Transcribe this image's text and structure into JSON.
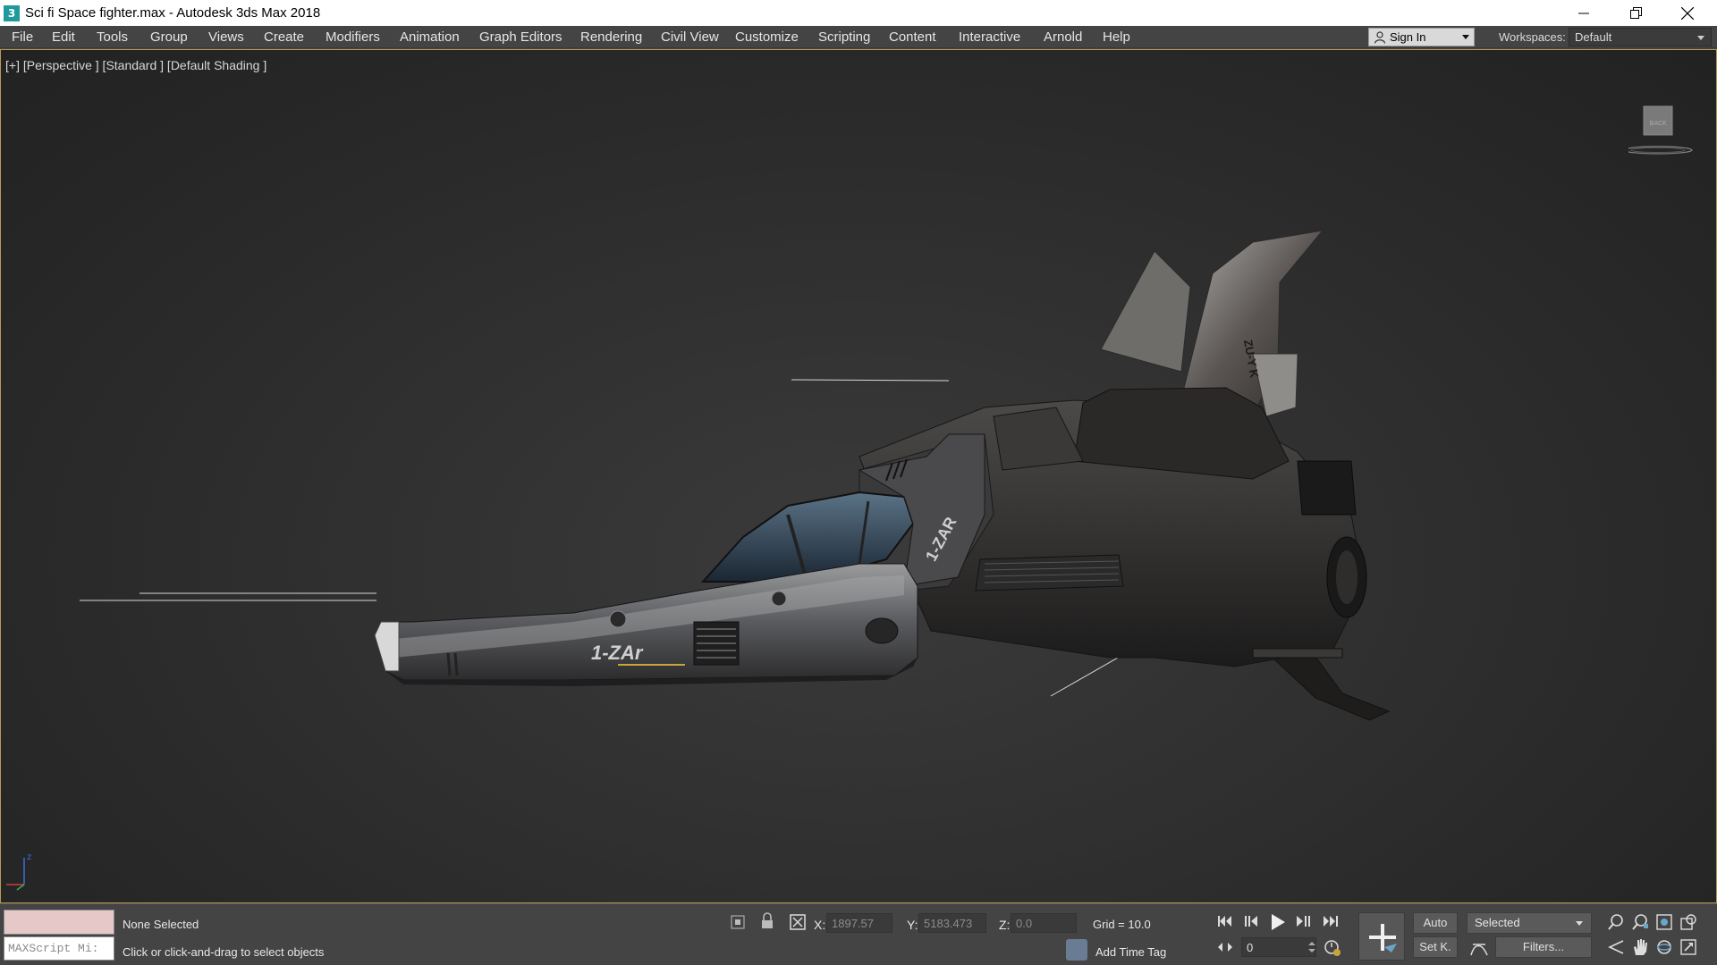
{
  "titlebar": {
    "app_icon": "3",
    "title": "Sci fi Space fighter.max - Autodesk 3ds Max 2018",
    "controls": [
      "minimize-icon",
      "restore-icon",
      "close-icon"
    ]
  },
  "menu": {
    "items": [
      "File",
      "Edit",
      "Tools",
      "Group",
      "Views",
      "Create",
      "Modifiers",
      "Animation",
      "Graph Editors",
      "Rendering",
      "Civil View",
      "Customize",
      "Scripting",
      "Content",
      "Interactive",
      "Arnold",
      "Help"
    ],
    "sign_in": "Sign In",
    "workspaces_label": "Workspaces:",
    "workspace": "Default"
  },
  "viewport": {
    "label": "[+] [Perspective ] [Standard ] [Default Shading ]",
    "viewcube": "BACK",
    "axis": "z",
    "ship_markings": [
      "1-ZAR",
      "1-ZAr",
      "ZU-Y K"
    ]
  },
  "status": {
    "selection": "None Selected",
    "prompt": "Click or click-and-drag to select objects",
    "maxscript_placeholder": "MAXScript Mi:",
    "x_label": "X:",
    "x_value": "1897.57",
    "y_label": "Y:",
    "y_value": "5183.473",
    "z_label": "Z:",
    "z_value": "0.0",
    "grid": "Grid = 10.0",
    "time_tag": "Add Time Tag",
    "frame": "0",
    "auto_key": "Auto",
    "set_key": "Set K.",
    "key_filter": "Selected",
    "filters": "Filters..."
  }
}
